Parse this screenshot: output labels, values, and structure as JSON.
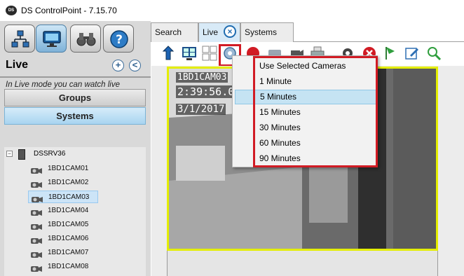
{
  "app": {
    "title": "DS ControlPoint - 7.15.70",
    "logo_text": "DS"
  },
  "nav": {
    "buttons": [
      {
        "name": "network-nav-button",
        "icon": "network-icon"
      },
      {
        "name": "live-nav-button",
        "icon": "monitor-icon",
        "active": true
      },
      {
        "name": "search-nav-button",
        "icon": "binoculars-icon"
      },
      {
        "name": "help-nav-button",
        "icon": "help-icon"
      }
    ],
    "section_title": "Live",
    "add_symbol": "+",
    "back_symbol": "<",
    "description": "In Live mode you can watch live sources of data.",
    "groups_label": "Groups",
    "systems_label": "Systems"
  },
  "tree": {
    "expander": "−",
    "server": "DSSRV36",
    "cameras": [
      {
        "label": "1BD1CAM01",
        "selected": false
      },
      {
        "label": "1BD1CAM02",
        "selected": false
      },
      {
        "label": "1BD1CAM03",
        "selected": true
      },
      {
        "label": "1BD1CAM04",
        "selected": false
      },
      {
        "label": "1BD1CAM05",
        "selected": false
      },
      {
        "label": "1BD1CAM06",
        "selected": false
      },
      {
        "label": "1BD1CAM07",
        "selected": false
      },
      {
        "label": "1BD1CAM08",
        "selected": false
      }
    ]
  },
  "tabs": {
    "search": "Search",
    "live": "Live",
    "systems": "Systems",
    "close_symbol": "×"
  },
  "toolbar": {
    "icons": [
      "back-arrow-icon",
      "monitor-grid-icon",
      "layout-grid-icon",
      "snapshot-icon",
      "record-icon",
      "camera-group-icon",
      "camera-icon",
      "printer-icon",
      "settings-gear-icon",
      "stop-icon",
      "flag-icon",
      "edit-icon",
      "zoom-icon"
    ]
  },
  "video": {
    "camera_name": "1BD1CAM03",
    "time": "2:39:56.0",
    "date": "3/1/2017"
  },
  "dropdown": {
    "items": [
      {
        "label": "Use Selected Cameras",
        "hover": false
      },
      {
        "label": "1 Minute",
        "hover": false
      },
      {
        "label": "5 Minutes",
        "hover": true
      },
      {
        "label": "15 Minutes",
        "hover": false
      },
      {
        "label": "30 Minutes",
        "hover": false
      },
      {
        "label": "60 Minutes",
        "hover": false
      },
      {
        "label": "90 Minutes",
        "hover": false
      }
    ]
  },
  "colors": {
    "highlight_red": "#d11b24",
    "video_border": "#e4ee00",
    "accent_blue": "#1f6cb0"
  }
}
